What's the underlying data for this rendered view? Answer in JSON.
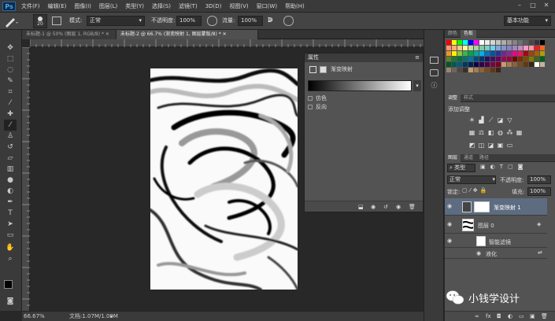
{
  "menubar": {
    "logo": "Ps",
    "items": [
      "文件(F)",
      "编辑(E)",
      "图像(I)",
      "图层(L)",
      "类型(Y)",
      "选择(S)",
      "滤镜(T)",
      "3D(D)",
      "视图(V)",
      "窗口(W)",
      "帮助(H)"
    ],
    "min": "–",
    "max": "□",
    "close": "✕"
  },
  "options": {
    "brush_size": "20",
    "mode_label": "模式:",
    "mode_value": "正常",
    "opacity_label": "不透明度:",
    "opacity_value": "100%",
    "flow_label": "流量:",
    "flow_value": "100%",
    "workspace": "基本功能"
  },
  "tabs": [
    "未标题-1 @ 50% (图层 1, RGB/8) *",
    "未标题-2 @ 66.7% (渐变映射 1, 图层蒙版/8) *"
  ],
  "status": {
    "zoom": "66.67%",
    "doc_size": "文档:1.07M/1.09M"
  },
  "properties": {
    "title": "属性",
    "adj_name": "渐变映射",
    "dither": "仿色",
    "reverse": "反向"
  },
  "swatches_panel": {
    "tabs": [
      "颜色",
      "色板"
    ],
    "colors": [
      "#ff0000",
      "#ffff00",
      "#00ff00",
      "#00ffff",
      "#0000ff",
      "#ff00ff",
      "#ffffff",
      "#ebebeb",
      "#d6d6d6",
      "#c2c2c2",
      "#adadad",
      "#999999",
      "#858585",
      "#707070",
      "#5c5c5c",
      "#474747",
      "#333333",
      "#000000",
      "#f7977a",
      "#f9ad81",
      "#fdc68a",
      "#fff79a",
      "#c4df9b",
      "#a2d39c",
      "#82ca9d",
      "#7bcdc8",
      "#6ecff6",
      "#7ea7d8",
      "#8493ca",
      "#8882be",
      "#a187be",
      "#bc8dbf",
      "#f49ac2",
      "#f6989d",
      "#ed1c24",
      "#f26522",
      "#f7941d",
      "#fff200",
      "#8dc73f",
      "#39b54a",
      "#00a651",
      "#00a99d",
      "#00aeef",
      "#0072bc",
      "#0054a6",
      "#2e3192",
      "#662d91",
      "#92278f",
      "#ec008c",
      "#ed145b",
      "#9e0b0f",
      "#a0410d",
      "#a36209",
      "#aba000",
      "#598527",
      "#1a7b30",
      "#007236",
      "#00746b",
      "#0076a3",
      "#004b80",
      "#003471",
      "#1b1464",
      "#440e62",
      "#630460",
      "#9e005d",
      "#9e0039",
      "#790000",
      "#7b2e00",
      "#7d4900",
      "#827b00",
      "#406618",
      "#005e20",
      "#005826",
      "#005952",
      "#005b7f",
      "#003663",
      "#002157",
      "#0d004c",
      "#32004b",
      "#4b0049",
      "#7b0046",
      "#7a0026",
      "#c69c6d",
      "#a67c52",
      "#8c6239",
      "#754c24",
      "#603913",
      "#3c2415",
      "#ffffff",
      "#c7b299",
      "#998675",
      "#736357",
      "#534741",
      "#37302a",
      "#c69c6d",
      "#a67c52",
      "#8c6239",
      "#754c24",
      "#603913",
      "#3c2415"
    ]
  },
  "adjustments_panel": {
    "tabs": [
      "调整",
      "样式"
    ],
    "title": "添加调整"
  },
  "layers_panel": {
    "tabs": [
      "图层",
      "通道",
      "路径"
    ],
    "kind": "类型",
    "blend": "正常",
    "opacity_label": "不透明度:",
    "opacity_value": "100%",
    "lock_label": "锁定:",
    "fill_label": "填充:",
    "fill_value": "100%",
    "layers": [
      {
        "name": "渐变映射 1",
        "selected": true
      },
      {
        "name": "图层 0",
        "selected": false
      },
      {
        "name": "智能滤镜",
        "selected": false
      },
      {
        "name": "液化",
        "selected": false
      }
    ]
  },
  "watermark": "小钱学设计"
}
